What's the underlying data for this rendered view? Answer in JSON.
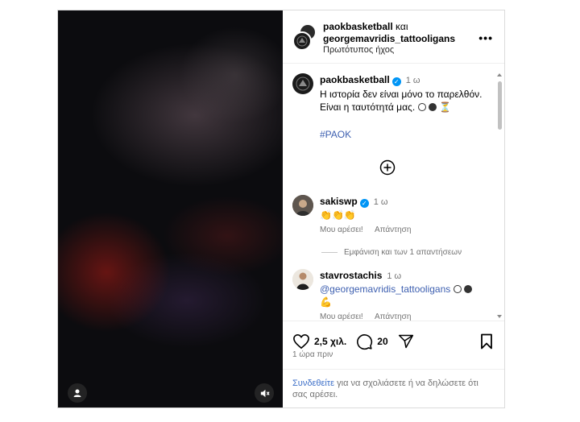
{
  "post": {
    "authors": [
      "paokbasketball",
      "georgemavridis_tattooligans"
    ],
    "joiner": "και",
    "audio": "Πρωτότυπος ήχος",
    "more_icon": "more-horizontal-icon"
  },
  "caption": {
    "username": "paokbasketball",
    "time": "1 ω",
    "text": "Η ιστορία δεν είναι μόνο το παρελθόν. Είναι η ταυτότητά μας.",
    "emojis": "⏳",
    "hashtag": "#PAOK"
  },
  "comments": [
    {
      "username": "sakiswp",
      "verified": true,
      "time": "1 ω",
      "text": "👏👏👏",
      "like": "Μου αρέσει!",
      "reply": "Απάντηση",
      "view_replies": "Εμφάνιση και των 1 απαντήσεων"
    },
    {
      "username": "stavrostachis",
      "verified": false,
      "time": "1 ω",
      "mention": "@georgemavridis_tattooligans",
      "trailing": "💪",
      "like": "Μου αρέσει!",
      "reply": "Απάντηση"
    }
  ],
  "actions": {
    "likes": "2,5 χιλ.",
    "comments": "20",
    "time_ago": "1 ώρα πριν"
  },
  "login": {
    "link": "Συνδεθείτε",
    "text": " για να σχολιάσετε ή να δηλώσετε ότι σας αρέσει."
  },
  "colors": {
    "link_blue": "#3d6fc8",
    "verified_blue": "#0095f6",
    "muted": "#737373"
  }
}
